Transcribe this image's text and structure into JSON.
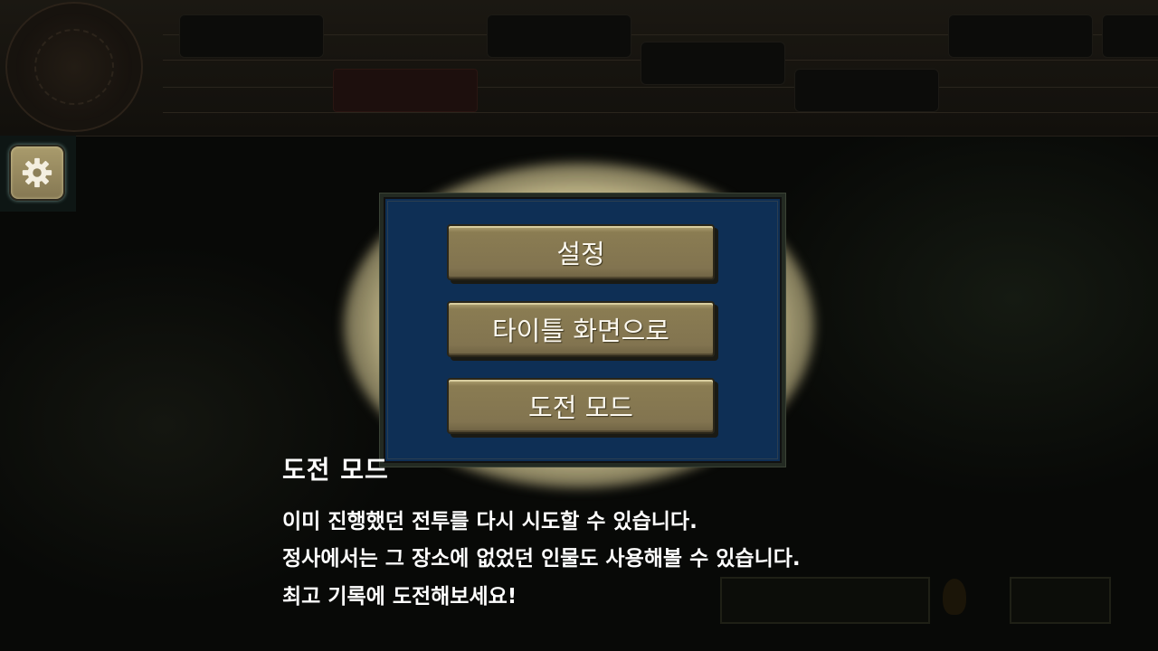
{
  "menu": {
    "items": [
      {
        "label": "설정"
      },
      {
        "label": "타이틀 화면으로"
      },
      {
        "label": "도전 모드"
      }
    ]
  },
  "description": {
    "title": "도전 모드",
    "lines": [
      "이미 진행했던 전투를 다시 시도할 수 있습니다.",
      "정사에서는 그 장소에 없었던 인물도 사용해볼 수 있습니다.",
      "최고 기록에 도전해보세요!"
    ]
  },
  "icons": {
    "settings": "gear-icon"
  },
  "colors": {
    "panel_bg": "#0e2f55",
    "button_bg": "#827450",
    "text": "#ffffff"
  }
}
